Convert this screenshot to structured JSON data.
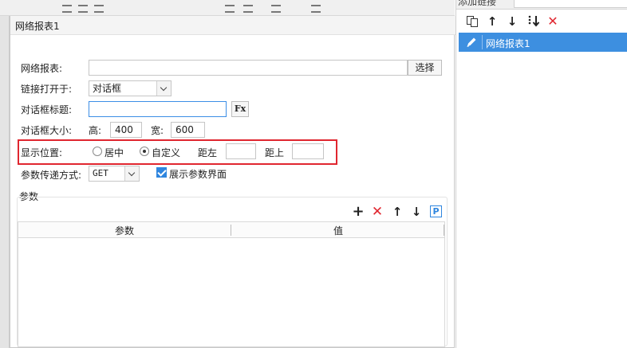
{
  "dialog": {
    "title": "网络报表1"
  },
  "form": {
    "report_label": "网络报表:",
    "report_value": "",
    "select_button": "选择",
    "open_in_label": "链接打开于:",
    "open_in_value": "对话框",
    "dialog_title_label": "对话框标题:",
    "dialog_title_value": "",
    "formula_button": "Fx",
    "dialog_size_label": "对话框大小:",
    "height_label": "高:",
    "height_value": "400",
    "width_label": "宽:",
    "width_value": "600",
    "position_label": "显示位置:",
    "position_options": [
      "居中",
      "自定义"
    ],
    "position_selected": "自定义",
    "left_label": "距左",
    "left_value": "",
    "top_label": "距上",
    "top_value": "",
    "param_method_label": "参数传递方式:",
    "param_method_value": "GET",
    "show_params_label": "展示参数界面",
    "show_params_checked": true
  },
  "params": {
    "section_title": "参数",
    "columns": [
      "参数",
      "值"
    ],
    "rows": []
  },
  "right_panel": {
    "header_text": "添加链接",
    "items": [
      {
        "label": "网络报表1",
        "selected": true
      }
    ]
  },
  "colors": {
    "accent": "#3d8fe0",
    "highlight_border": "#e0262f",
    "delete": "#e0262f",
    "param_p_icon": "#2f86df"
  }
}
